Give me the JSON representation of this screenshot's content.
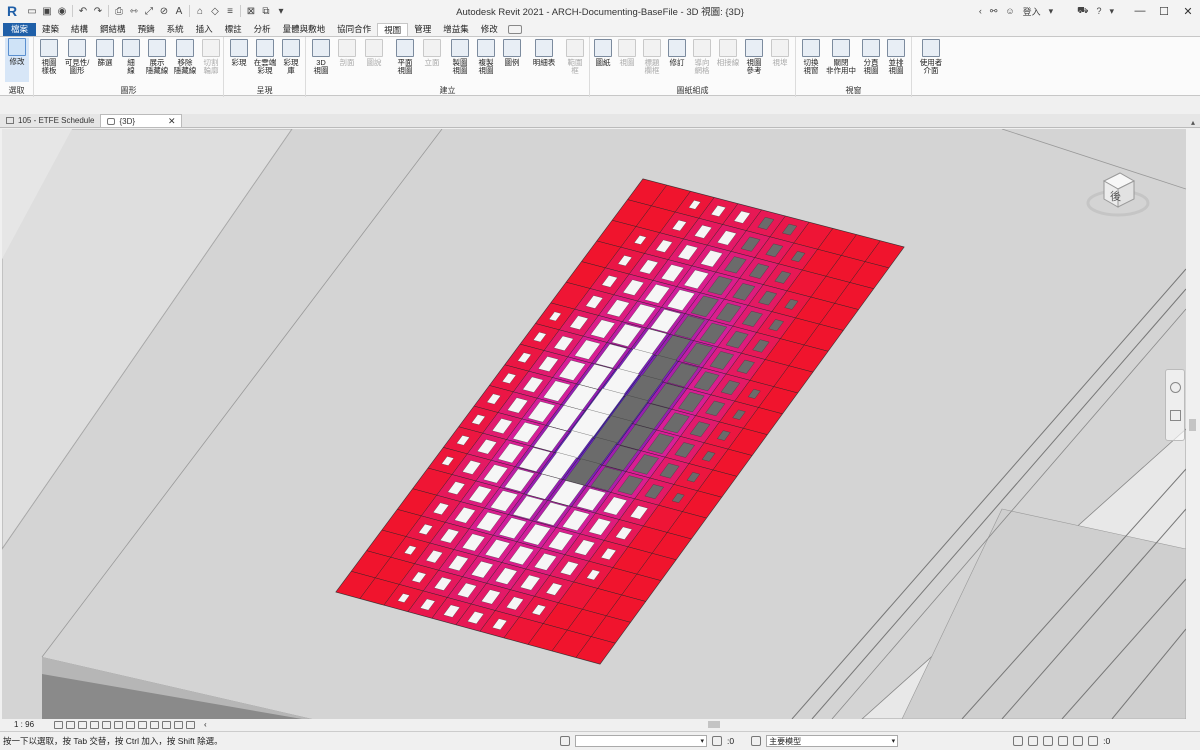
{
  "app": {
    "window_title": "Autodesk Revit 2021 - ARCH-Documenting-BaseFile - 3D 視圖: {3D}",
    "logo": "R",
    "sign_in_label": "登入",
    "brand_color": "#1f5fa8"
  },
  "ribbon_tabs": [
    {
      "label": "檔案"
    },
    {
      "label": "建築"
    },
    {
      "label": "結構"
    },
    {
      "label": "鋼結構"
    },
    {
      "label": "預鑄"
    },
    {
      "label": "系統"
    },
    {
      "label": "插入"
    },
    {
      "label": "標註"
    },
    {
      "label": "分析"
    },
    {
      "label": "量體與敷地"
    },
    {
      "label": "協同合作"
    },
    {
      "label": "視圖"
    },
    {
      "label": "管理"
    },
    {
      "label": "增益集"
    },
    {
      "label": "修改"
    }
  ],
  "ribbon": {
    "modify_label": "修改",
    "select_label": "選取",
    "groups": {
      "graphics": "圖形",
      "presentation": "呈現",
      "create": "建立",
      "sheet_composition": "圖紙組成",
      "windows": "視窗"
    },
    "buttons": {
      "view_templates": "視圖\n樣板",
      "visibility_graphics": "可見性/\n圖形",
      "filters": "篩選",
      "thin_lines": "細\n線",
      "show_hidden_lines": "展示\n隱藏線",
      "remove_hidden_lines": "移除\n隱藏線",
      "cut_profile": "切割\n輪廓",
      "render": "彩現",
      "render_in_cloud": "在雲端\n彩現",
      "render_gallery": "彩現\n庫",
      "view_3d": "3D\n視圖",
      "section": "剖面",
      "callout": "圖說",
      "plan_views": "平面\n視圖",
      "elevation": "立面",
      "drafting_view": "製圖\n視圖",
      "duplicate_view": "複製\n視圖",
      "legends": "圖例",
      "schedules": "明細表",
      "scope_box": "範圍\n框",
      "sheet": "圖紙",
      "view": "視圖",
      "title_block": "標題\n欄框",
      "revisions": "修訂",
      "guide_grid": "導向\n網格",
      "matchline": "相接線",
      "view_reference": "視圖\n參考",
      "viewports": "視埠",
      "switch_windows": "切換\n視窗",
      "close_inactive": "關閉\n非作用中",
      "tab_views": "分頁\n視圖",
      "tile_views": "並排\n視圖",
      "user_interface": "使用者\n介面"
    }
  },
  "doc_tabs": [
    {
      "label": "105 - ETFE Schedule"
    },
    {
      "label": "{3D}"
    }
  ],
  "view_cube": {
    "face_label": "後"
  },
  "view_control": {
    "scale": "1 : 96"
  },
  "status": {
    "hint": "按一下以選取，按 Tab 交替，按 Ctrl 加入，按 Shift 除選。",
    "workset_count": ":0",
    "design_option": "主要模型",
    "filter_count": ":0"
  },
  "colors": {
    "panel_red": "#f0142d",
    "panel_magenta": "#d81e9a",
    "panel_blue": "#2a1fd9",
    "background": "#d4d4d4"
  }
}
